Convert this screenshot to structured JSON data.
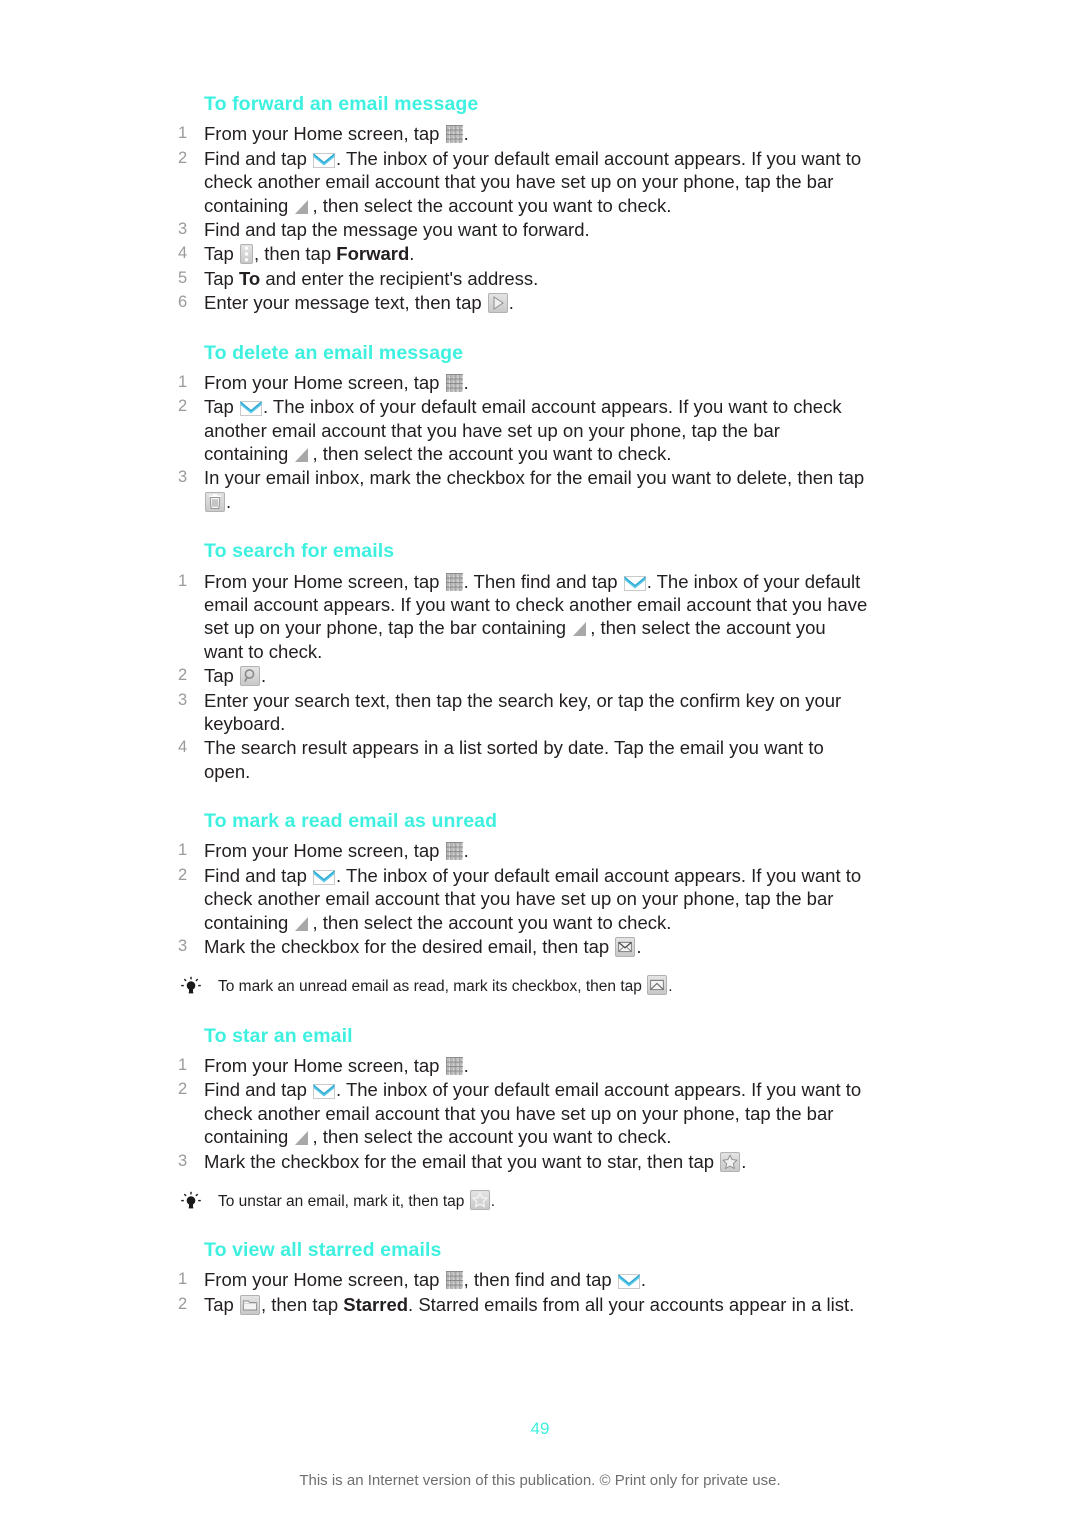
{
  "document": {
    "page_number": "49",
    "footer_note": "This is an Internet version of this publication. © Print only for private use.",
    "heading_color": "#3ef0df",
    "body_color": "#231f20",
    "number_color": "#9a9a9a"
  },
  "sections": [
    {
      "id": "forward-email",
      "heading": "To forward an email message",
      "steps": [
        {
          "parts": [
            {
              "text": "From your Home screen, tap "
            },
            {
              "icon": "app-drawer-grid-icon"
            },
            {
              "text": "."
            }
          ]
        },
        {
          "parts": [
            {
              "text": "Find and tap "
            },
            {
              "icon": "envelope-icon"
            },
            {
              "text": ". The inbox of your default email account appears. If you want to check another email account that you have set up on your phone, tap the bar containing "
            },
            {
              "icon": "dropdown-triangle-icon"
            },
            {
              "text": ", then select the account you want to check."
            }
          ]
        },
        {
          "parts": [
            {
              "text": "Find and tap the message you want to forward."
            }
          ]
        },
        {
          "parts": [
            {
              "text": "Tap "
            },
            {
              "icon": "more-options-icon"
            },
            {
              "text": ", then tap "
            },
            {
              "bold": "Forward"
            },
            {
              "text": "."
            }
          ]
        },
        {
          "parts": [
            {
              "text": "Tap "
            },
            {
              "bold": "To"
            },
            {
              "text": " and enter the recipient's address."
            }
          ]
        },
        {
          "parts": [
            {
              "text": "Enter your message text, then tap "
            },
            {
              "icon": "send-arrow-icon"
            },
            {
              "text": "."
            }
          ]
        }
      ],
      "tip": null
    },
    {
      "id": "delete-email",
      "heading": "To delete an email message",
      "steps": [
        {
          "parts": [
            {
              "text": "From your Home screen, tap "
            },
            {
              "icon": "app-drawer-grid-icon"
            },
            {
              "text": "."
            }
          ]
        },
        {
          "parts": [
            {
              "text": "Tap "
            },
            {
              "icon": "envelope-icon"
            },
            {
              "text": ". The inbox of your default email account appears. If you want to check another email account that you have set up on your phone, tap the bar containing "
            },
            {
              "icon": "dropdown-triangle-icon"
            },
            {
              "text": ", then select the account you want to check."
            }
          ]
        },
        {
          "parts": [
            {
              "text": "In your email inbox, mark the checkbox for the email you want to delete, then tap "
            },
            {
              "icon": "trash-icon"
            },
            {
              "text": "."
            }
          ]
        }
      ],
      "tip": null
    },
    {
      "id": "search-emails",
      "heading": "To search for emails",
      "steps": [
        {
          "parts": [
            {
              "text": "From your Home screen, tap "
            },
            {
              "icon": "app-drawer-grid-icon"
            },
            {
              "text": ". Then find and tap "
            },
            {
              "icon": "envelope-icon"
            },
            {
              "text": ". The inbox of your default email account appears. If you want to check another email account that you have set up on your phone, tap the bar containing "
            },
            {
              "icon": "dropdown-triangle-icon"
            },
            {
              "text": ", then select the account you want to check."
            }
          ]
        },
        {
          "parts": [
            {
              "text": "Tap "
            },
            {
              "icon": "search-icon"
            },
            {
              "text": "."
            }
          ]
        },
        {
          "parts": [
            {
              "text": "Enter your search text, then tap the search key, or tap the confirm key on your keyboard."
            }
          ]
        },
        {
          "parts": [
            {
              "text": "The search result appears in a list sorted by date. Tap the email you want to open."
            }
          ]
        }
      ],
      "tip": null
    },
    {
      "id": "mark-read-as-unread",
      "heading": "To mark a read email as unread",
      "steps": [
        {
          "parts": [
            {
              "text": "From your Home screen, tap "
            },
            {
              "icon": "app-drawer-grid-icon"
            },
            {
              "text": "."
            }
          ]
        },
        {
          "parts": [
            {
              "text": "Find and tap "
            },
            {
              "icon": "envelope-icon"
            },
            {
              "text": ". The inbox of your default email account appears. If you want to check another email account that you have set up on your phone, tap the bar containing "
            },
            {
              "icon": "dropdown-triangle-icon"
            },
            {
              "text": ", then select the account you want to check."
            }
          ]
        },
        {
          "parts": [
            {
              "text": "Mark the checkbox for the desired email, then tap "
            },
            {
              "icon": "mark-unread-icon"
            },
            {
              "text": "."
            }
          ]
        }
      ],
      "tip": {
        "parts": [
          {
            "text": "To mark an unread email as read, mark its checkbox, then tap "
          },
          {
            "icon": "mark-read-icon"
          },
          {
            "text": "."
          }
        ]
      }
    },
    {
      "id": "star-email",
      "heading": "To star an email",
      "steps": [
        {
          "parts": [
            {
              "text": "From your Home screen, tap "
            },
            {
              "icon": "app-drawer-grid-icon"
            },
            {
              "text": "."
            }
          ]
        },
        {
          "parts": [
            {
              "text": "Find and tap "
            },
            {
              "icon": "envelope-icon"
            },
            {
              "text": ". The inbox of your default email account appears. If you want to check another email account that you have set up on your phone, tap the bar containing "
            },
            {
              "icon": "dropdown-triangle-icon"
            },
            {
              "text": ", then select the account you want to check."
            }
          ]
        },
        {
          "parts": [
            {
              "text": "Mark the checkbox for the email that you want to star, then tap "
            },
            {
              "icon": "star-filled-icon"
            },
            {
              "text": "."
            }
          ]
        }
      ],
      "tip": {
        "parts": [
          {
            "text": "To unstar an email, mark it, then tap "
          },
          {
            "icon": "star-outline-icon"
          },
          {
            "text": "."
          }
        ]
      }
    },
    {
      "id": "view-starred-emails",
      "heading": "To view all starred emails",
      "steps": [
        {
          "parts": [
            {
              "text": "From your Home screen, tap "
            },
            {
              "icon": "app-drawer-grid-icon"
            },
            {
              "text": ", then find and tap "
            },
            {
              "icon": "envelope-icon"
            },
            {
              "text": "."
            }
          ]
        },
        {
          "parts": [
            {
              "text": "Tap "
            },
            {
              "icon": "folder-icon"
            },
            {
              "text": ", then tap "
            },
            {
              "bold": "Starred"
            },
            {
              "text": ". Starred emails from all your accounts appear in a list."
            }
          ]
        }
      ],
      "tip": null
    }
  ]
}
